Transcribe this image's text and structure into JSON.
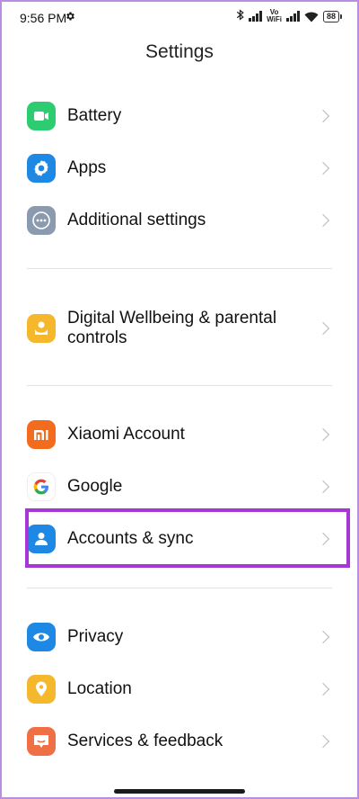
{
  "status_bar": {
    "time": "9:56 PM",
    "vowifi_top": "Vo",
    "vowifi_bottom": "WiFi",
    "battery": "88"
  },
  "page": {
    "title": "Settings"
  },
  "sections": [
    {
      "items": [
        {
          "id": "battery",
          "label": "Battery",
          "icon": "battery-icon",
          "color": "#2ecc71"
        },
        {
          "id": "apps",
          "label": "Apps",
          "icon": "gear-icon",
          "color": "#1e88e5"
        },
        {
          "id": "additional-settings",
          "label": "Additional settings",
          "icon": "more-dots-icon",
          "color": "#8a9bb0"
        }
      ]
    },
    {
      "items": [
        {
          "id": "digital-wellbeing",
          "label_line1": "Digital Wellbeing & parental",
          "label_line2": "controls",
          "icon": "wellbeing-icon",
          "color": "#f5b72b"
        }
      ]
    },
    {
      "items": [
        {
          "id": "xiaomi-account",
          "label": "Xiaomi Account",
          "icon": "mi-logo-icon",
          "color": "#f36b1c"
        },
        {
          "id": "google",
          "label": "Google",
          "icon": "google-logo-icon",
          "color": "#ffffff"
        },
        {
          "id": "accounts-sync",
          "label": "Accounts & sync",
          "icon": "person-icon",
          "color": "#1e88e5",
          "highlighted": true
        }
      ]
    },
    {
      "items": [
        {
          "id": "privacy",
          "label": "Privacy",
          "icon": "eye-icon",
          "color": "#1e88e5"
        },
        {
          "id": "location",
          "label": "Location",
          "icon": "location-pin-icon",
          "color": "#f5b72b"
        },
        {
          "id": "services-feedback",
          "label": "Services & feedback",
          "icon": "feedback-icon",
          "color": "#f07046"
        }
      ]
    }
  ],
  "colors": {
    "highlight": "#a637d6",
    "chevron": "#b8b8b8",
    "divider": "#e3e3e3"
  }
}
